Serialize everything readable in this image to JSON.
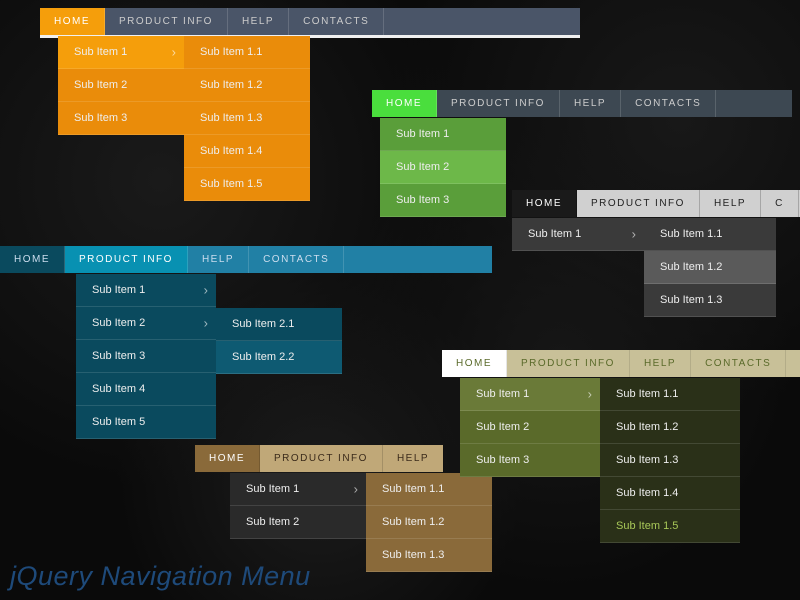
{
  "title": "jQuery Navigation Menu",
  "nav": {
    "home": "HOME",
    "product": "PRODUCT INFO",
    "help": "HELP",
    "contacts": "CONTACTS"
  },
  "orange": {
    "sub": [
      "Sub Item 1",
      "Sub Item 2",
      "Sub Item 3"
    ],
    "sub2": [
      "Sub Item 1.1",
      "Sub Item 1.2",
      "Sub Item 1.3",
      "Sub Item 1.4",
      "Sub Item 1.5"
    ]
  },
  "green": {
    "sub": [
      "Sub Item 1",
      "Sub Item 2",
      "Sub Item 3"
    ]
  },
  "gray": {
    "sub": [
      "Sub Item 1"
    ],
    "sub2": [
      "Sub Item 1.1",
      "Sub Item 1.2",
      "Sub Item 1.3"
    ]
  },
  "teal": {
    "sub": [
      "Sub Item 1",
      "Sub Item 2",
      "Sub Item 3",
      "Sub Item 4",
      "Sub Item 5"
    ],
    "sub2": [
      "Sub Item 2.1",
      "Sub Item 2.2"
    ]
  },
  "brown": {
    "sub": [
      "Sub Item 1",
      "Sub Item 2"
    ],
    "sub2": [
      "Sub Item 1.1",
      "Sub Item 1.2",
      "Sub Item 1.3"
    ]
  },
  "olive": {
    "sub": [
      "Sub Item 1",
      "Sub Item 2",
      "Sub Item 3"
    ],
    "sub2": [
      "Sub Item 1.1",
      "Sub Item 1.2",
      "Sub Item 1.3",
      "Sub Item 1.4",
      "Sub Item 1.5"
    ]
  }
}
